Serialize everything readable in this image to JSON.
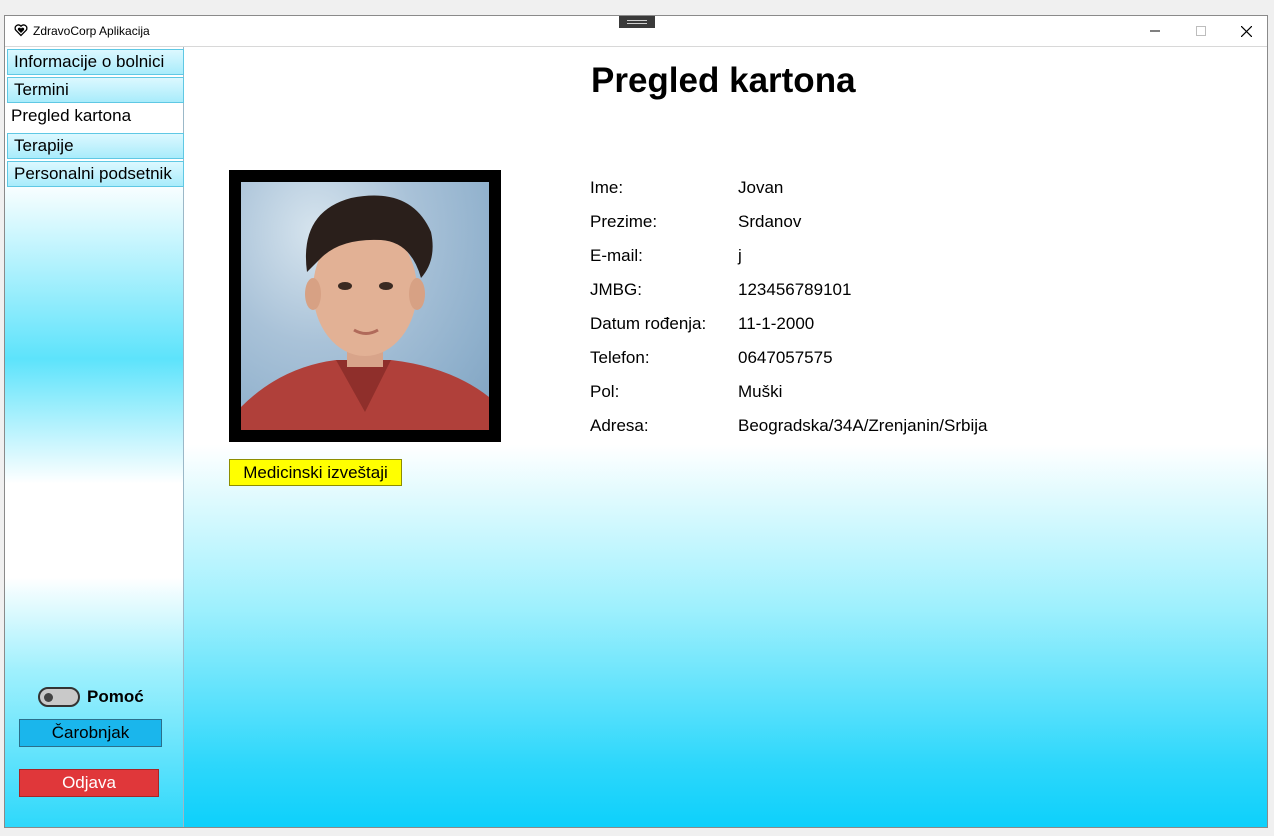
{
  "window": {
    "title": "ZdravoCorp Aplikacija"
  },
  "sidebar": {
    "items": [
      {
        "label": "Informacije o bolnici"
      },
      {
        "label": "Termini"
      },
      {
        "label": "Pregled kartona"
      },
      {
        "label": "Terapije"
      },
      {
        "label": "Personalni podsetnik"
      }
    ],
    "help_toggle_label": "Pomoć",
    "help_toggle_on": false,
    "wizard_label": "Čarobnjak",
    "logout_label": "Odjava"
  },
  "main": {
    "title": "Pregled kartona",
    "medical_reports_label": "Medicinski izveštaji",
    "fields": [
      {
        "label": "Ime:",
        "value": "Jovan"
      },
      {
        "label": "Prezime:",
        "value": "Srdanov"
      },
      {
        "label": "E-mail:",
        "value": "j"
      },
      {
        "label": "JMBG:",
        "value": "123456789101"
      },
      {
        "label": "Datum rođenja:",
        "value": "11-1-2000"
      },
      {
        "label": "Telefon:",
        "value": "0647057575"
      },
      {
        "label": "Pol:",
        "value": "Muški"
      },
      {
        "label": "Adresa:",
        "value": "Beogradska/34A/Zrenjanin/Srbija"
      }
    ]
  }
}
